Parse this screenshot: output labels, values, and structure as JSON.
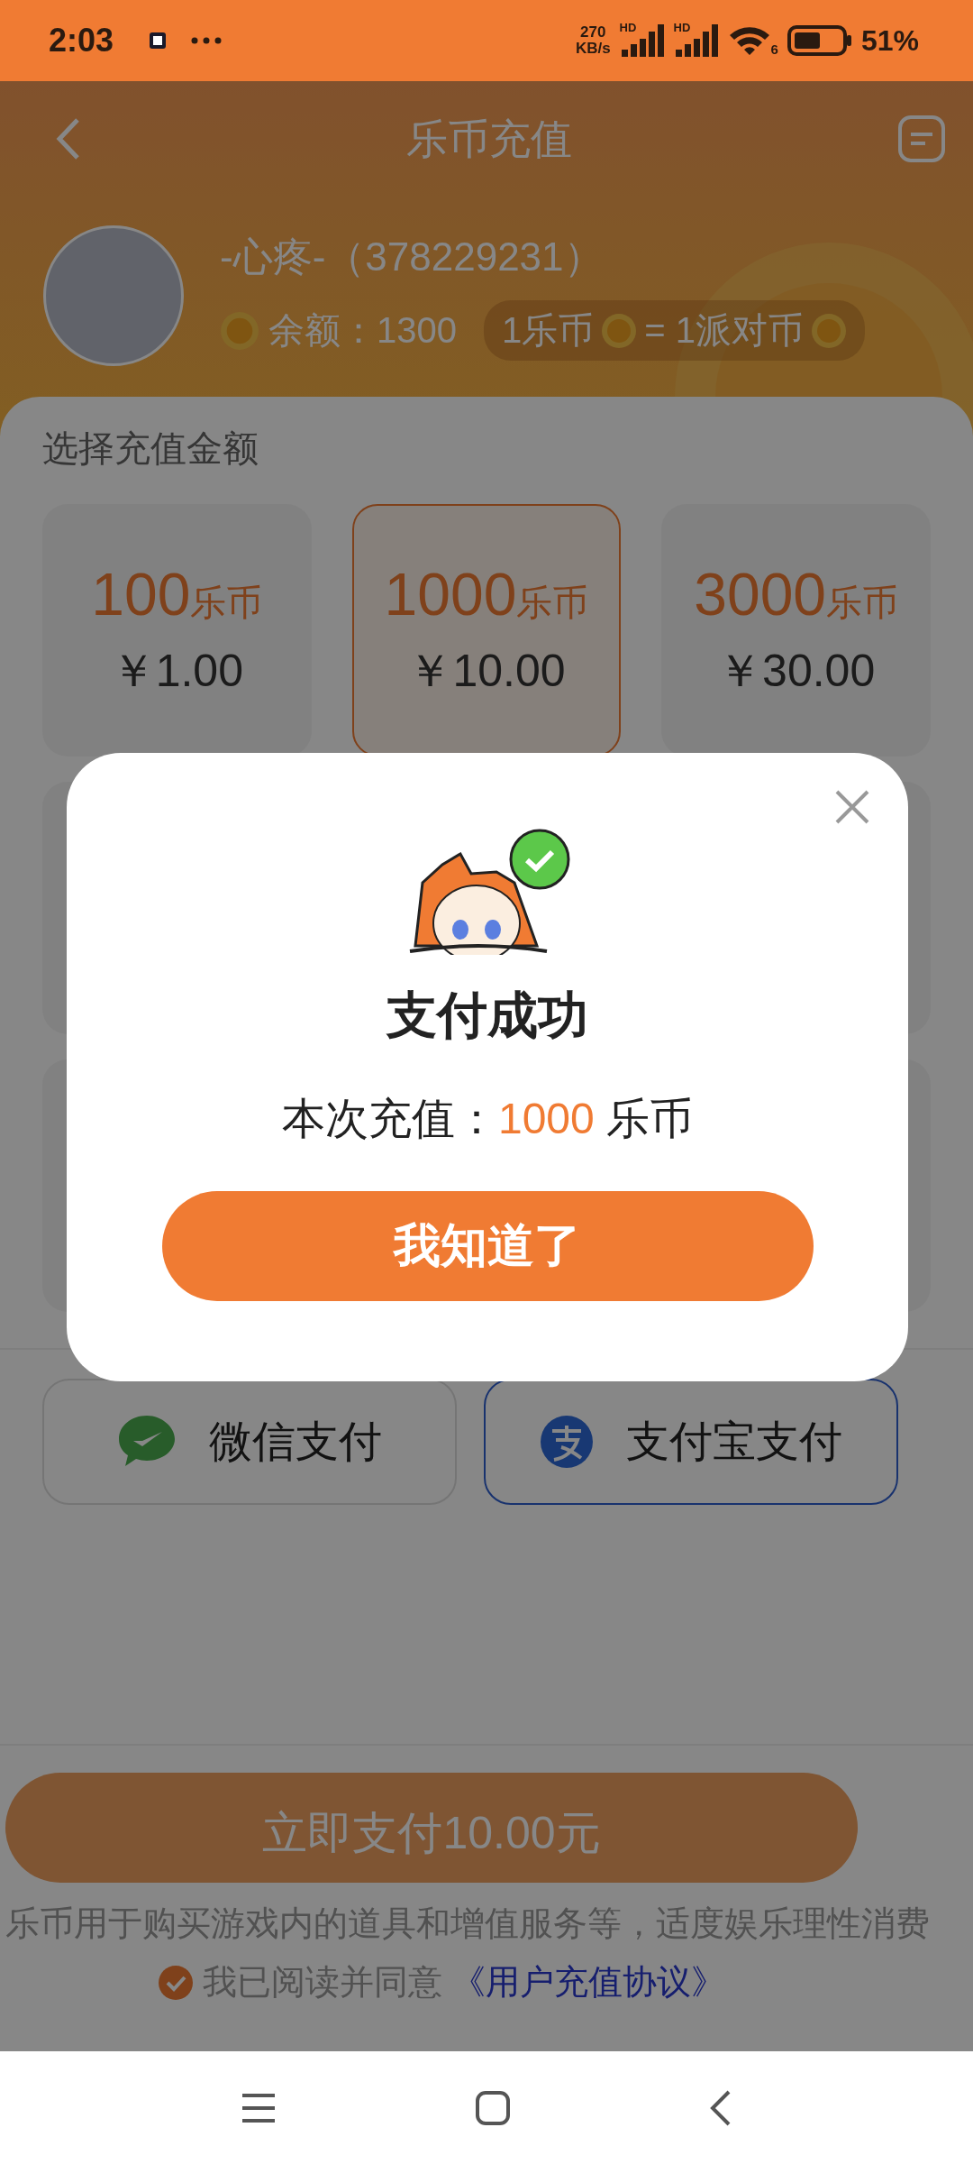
{
  "status_bar": {
    "time": "2:03",
    "net_speed": [
      "270",
      "KB/s"
    ],
    "signal_labels": [
      "HD",
      "HD"
    ],
    "wifi_label": "6",
    "battery": "51%"
  },
  "header": {
    "title": "乐币充值"
  },
  "profile": {
    "name": "-心疼-（378229231）",
    "balance": "余额：1300",
    "exchange": [
      "1乐币",
      "= 1派对币"
    ]
  },
  "section_title": "选择充值金额",
  "options": [
    {
      "amount": "100",
      "unit": "乐币",
      "price": "￥1.00",
      "selected": false
    },
    {
      "amount": "1000",
      "unit": "乐币",
      "price": "￥10.00",
      "selected": true
    },
    {
      "amount": "3000",
      "unit": "乐币",
      "price": "￥30.00",
      "selected": false
    }
  ],
  "payment_methods": [
    {
      "kind": "wechat",
      "label": "微信支付",
      "selected": false
    },
    {
      "kind": "alipay",
      "label": "支付宝支付",
      "selected": true
    }
  ],
  "pay_button": "立即支付10.00元",
  "notice": "乐币用于购买游戏内的道具和增值服务等，适度娱乐理性消费",
  "agreement": {
    "checked": true,
    "text": "我已阅读并同意",
    "link": "《用户充值协议》"
  },
  "dialog": {
    "title": "支付成功",
    "message_prefix": "本次充值：",
    "amount": "1000",
    "unit": "乐币",
    "button": "我知道了"
  }
}
